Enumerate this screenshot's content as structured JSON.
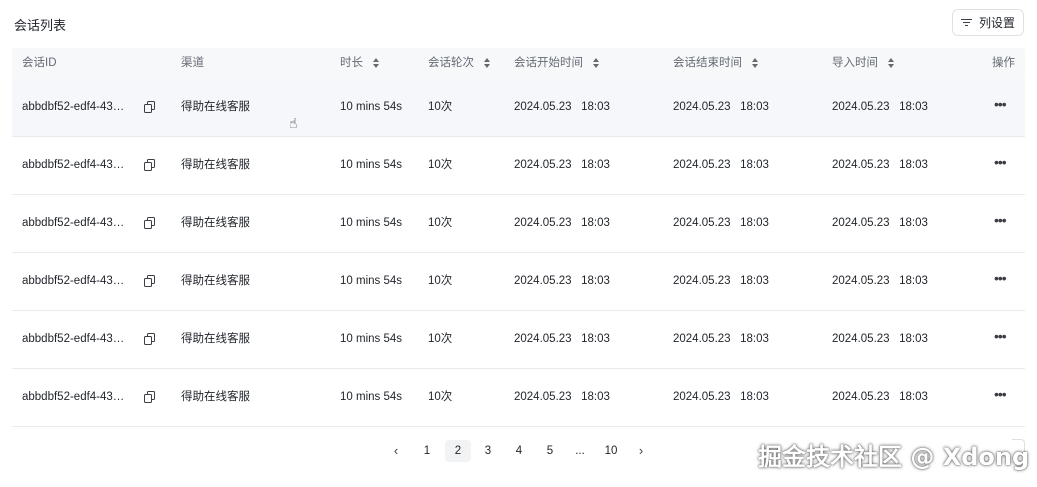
{
  "header": {
    "title": "会话列表",
    "column_settings_label": "列设置"
  },
  "columns": [
    {
      "label": "会话ID",
      "sortable": false
    },
    {
      "label": "渠道",
      "sortable": false
    },
    {
      "label": "时长",
      "sortable": true
    },
    {
      "label": "会话轮次",
      "sortable": true
    },
    {
      "label": "会话开始时间",
      "sortable": true
    },
    {
      "label": "会话结束时间",
      "sortable": true
    },
    {
      "label": "导入时间",
      "sortable": true
    },
    {
      "label": "操作",
      "sortable": false
    }
  ],
  "rows": [
    {
      "id": "abbdbf52-edf4-43…",
      "channel": "得助在线客服",
      "duration": "10 mins 54s",
      "rounds": "10次",
      "start": "2024.05.23   18:03",
      "end": "2024.05.23   18:03",
      "imported": "2024.05.23   18:03"
    },
    {
      "id": "abbdbf52-edf4-43…",
      "channel": "得助在线客服",
      "duration": "10 mins 54s",
      "rounds": "10次",
      "start": "2024.05.23   18:03",
      "end": "2024.05.23   18:03",
      "imported": "2024.05.23   18:03"
    },
    {
      "id": "abbdbf52-edf4-43…",
      "channel": "得助在线客服",
      "duration": "10 mins 54s",
      "rounds": "10次",
      "start": "2024.05.23   18:03",
      "end": "2024.05.23   18:03",
      "imported": "2024.05.23   18:03"
    },
    {
      "id": "abbdbf52-edf4-43…",
      "channel": "得助在线客服",
      "duration": "10 mins 54s",
      "rounds": "10次",
      "start": "2024.05.23   18:03",
      "end": "2024.05.23   18:03",
      "imported": "2024.05.23   18:03"
    },
    {
      "id": "abbdbf52-edf4-43…",
      "channel": "得助在线客服",
      "duration": "10 mins 54s",
      "rounds": "10次",
      "start": "2024.05.23   18:03",
      "end": "2024.05.23   18:03",
      "imported": "2024.05.23   18:03"
    },
    {
      "id": "abbdbf52-edf4-43…",
      "channel": "得助在线客服",
      "duration": "10 mins 54s",
      "rounds": "10次",
      "start": "2024.05.23   18:03",
      "end": "2024.05.23   18:03",
      "imported": "2024.05.23   18:03"
    }
  ],
  "pagination": {
    "prev": "‹",
    "pages": [
      "1",
      "2",
      "3",
      "4",
      "5",
      "...",
      "10"
    ],
    "current": "2",
    "next": "›"
  },
  "watermark": "掘金技术社区 @ Xdong",
  "icons": {
    "copy": "copy-icon",
    "more": "more-icon",
    "filter": "filter-icon",
    "sort": "sort-icon"
  }
}
